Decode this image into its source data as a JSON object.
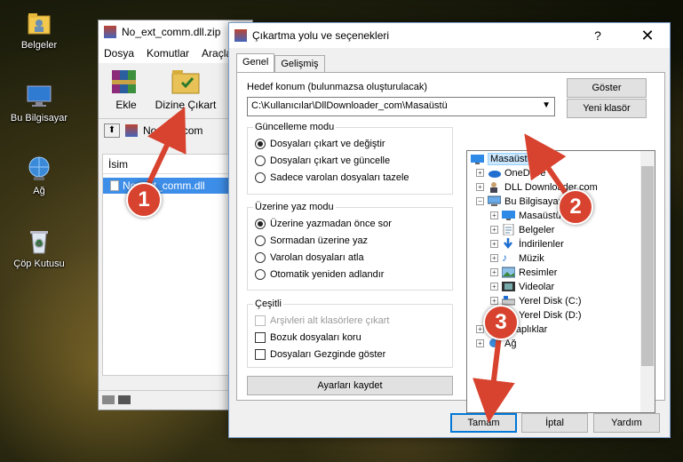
{
  "colors": {
    "accent": "#0078d7",
    "badge": "#d8432f",
    "selection": "#3d8ee8"
  },
  "desktop": {
    "icons": [
      {
        "label": "Belgeler",
        "icon": "folder-user-icon"
      },
      {
        "label": "Bu Bilgisayar",
        "icon": "computer-icon"
      },
      {
        "label": "Ağ",
        "icon": "network-icon"
      },
      {
        "label": "Çöp Kutusu",
        "icon": "recycle-bin-icon"
      }
    ]
  },
  "winrar": {
    "title": "No_ext_comm.dll.zip",
    "menu": [
      "Dosya",
      "Komutlar",
      "Araçla"
    ],
    "toolbar": {
      "extract_label": "Ekle",
      "extract_to_label": "Dizine Çıkart"
    },
    "address": "No_ext_com",
    "list_header": "İsim",
    "file_name": "No_ext_comm.dll"
  },
  "dialog": {
    "title": "Çıkartma yolu ve seçenekleri",
    "help": "?",
    "close": "✕",
    "tabs": [
      "Genel",
      "Gelişmiş"
    ],
    "dest_label": "Hedef konum (bulunmazsa oluşturulacak)",
    "dest_value": "C:\\Kullanıcılar\\DllDownloader_com\\Masaüstü",
    "show_button": "Göster",
    "new_folder_button": "Yeni klasör",
    "update_group": {
      "title": "Güncelleme modu",
      "options": [
        "Dosyaları çıkart ve değiştir",
        "Dosyaları çıkart ve güncelle",
        "Sadece varolan dosyaları tazele"
      ],
      "selected": 0
    },
    "overwrite_group": {
      "title": "Üzerine yaz modu",
      "options": [
        "Üzerine yazmadan önce sor",
        "Sormadan üzerine yaz",
        "Varolan dosyaları atla",
        "Otomatik yeniden adlandır"
      ],
      "selected": 0
    },
    "misc_group": {
      "title": "Çeşitli",
      "options": [
        "Arşivleri alt klasörlere çıkart",
        "Bozuk dosyaları koru",
        "Dosyaları Gezginde göster"
      ]
    },
    "save_settings": "Ayarları kaydet",
    "tree": [
      {
        "label": "Masaüstü",
        "icon": "desktop-icon"
      },
      {
        "label": "OneDrive",
        "icon": "cloud-icon"
      },
      {
        "label": "DLL Downloader.com",
        "icon": "user-icon"
      },
      {
        "label": "Bu Bilgisayar",
        "icon": "computer-icon"
      },
      {
        "label": "Masaüstü",
        "icon": "desktop-icon"
      },
      {
        "label": "Belgeler",
        "icon": "documents-icon"
      },
      {
        "label": "İndirilenler",
        "icon": "download-icon"
      },
      {
        "label": "Müzik",
        "icon": "music-icon"
      },
      {
        "label": "Resimler",
        "icon": "pictures-icon"
      },
      {
        "label": "Videolar",
        "icon": "video-icon"
      },
      {
        "label": "Yerel Disk (C:)",
        "icon": "disk-icon"
      },
      {
        "label": "Yerel Disk (D:)",
        "icon": "disk-icon"
      },
      {
        "label": "Kitaplıklar",
        "icon": "library-icon"
      },
      {
        "label": "Ağ",
        "icon": "network-icon"
      }
    ],
    "ok_button": "Tamam",
    "cancel_button": "İptal",
    "help_button": "Yardım"
  },
  "annotations": [
    "1",
    "2",
    "3"
  ]
}
